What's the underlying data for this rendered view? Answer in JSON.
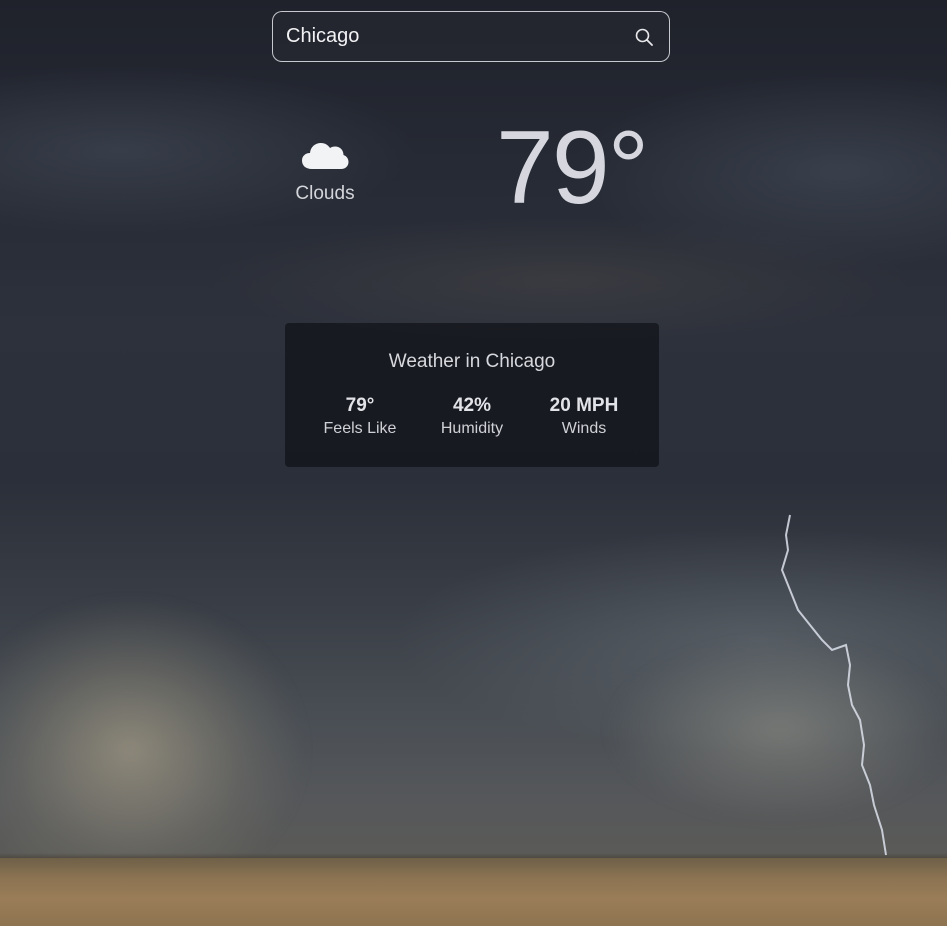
{
  "search": {
    "value": "Chicago",
    "icon": "search-icon"
  },
  "current": {
    "condition_icon": "cloud-icon",
    "condition": "Clouds",
    "temperature": "79°"
  },
  "details": {
    "title": "Weather in Chicago",
    "stats": [
      {
        "value": "79°",
        "label": "Feels Like"
      },
      {
        "value": "42%",
        "label": "Humidity"
      },
      {
        "value": "20 MPH",
        "label": "Winds"
      }
    ]
  },
  "colors": {
    "text_primary": "#d6d7de",
    "card_background": "#0c0d12",
    "search_border": "#e6e6eb"
  }
}
